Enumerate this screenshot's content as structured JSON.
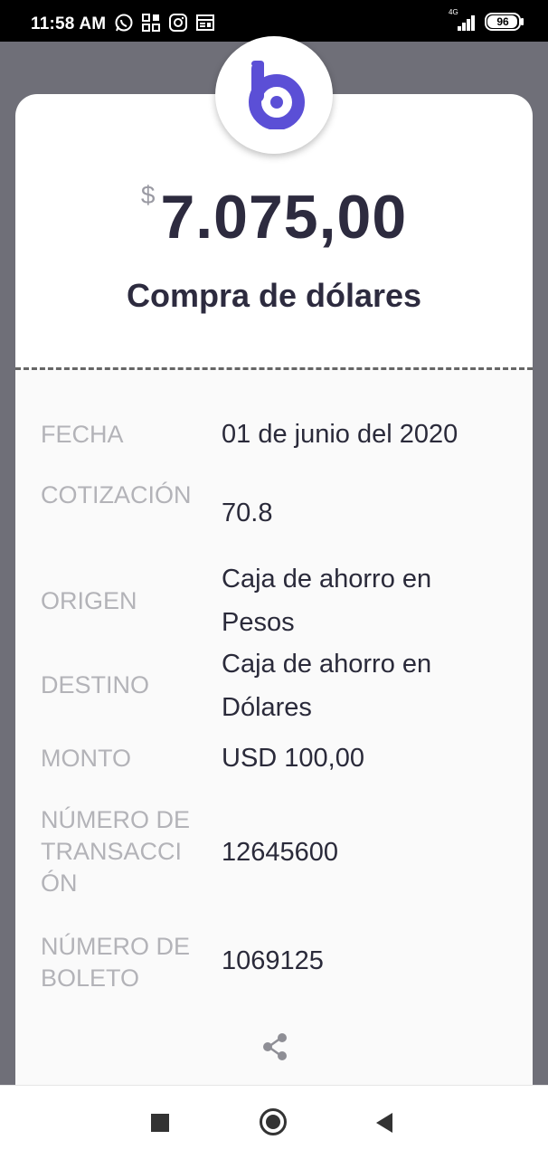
{
  "status_bar": {
    "time": "11:58 AM",
    "network": "4G",
    "battery": "96",
    "icons": [
      "whatsapp-icon",
      "app-grid-icon",
      "instagram-icon",
      "news-icon"
    ]
  },
  "receipt": {
    "currency_symbol": "$",
    "amount": "7.075,00",
    "title": "Compra de dólares",
    "details": [
      {
        "label": "FECHA",
        "value": "01 de junio del 2020"
      },
      {
        "label": "COTIZACIÓN",
        "value": "70.8"
      },
      {
        "label": "ORIGEN",
        "value": "Caja de ahorro en Pesos"
      },
      {
        "label": "DESTINO",
        "value": "Caja de ahorro en Dólares"
      },
      {
        "label": "MONTO",
        "value": "USD 100,00"
      },
      {
        "label": "NÚMERO DE TRANSACCIÓN",
        "value": "12645600"
      },
      {
        "label": "NÚMERO DE BOLETO",
        "value": "1069125"
      }
    ]
  },
  "colors": {
    "brand": "#5b4fd6",
    "text_dark": "#2d2b3f",
    "label_gray": "#b3b3b8",
    "backdrop": "#6f6f78"
  },
  "nav_bar": {
    "buttons": [
      "recent-apps",
      "home",
      "back"
    ]
  }
}
